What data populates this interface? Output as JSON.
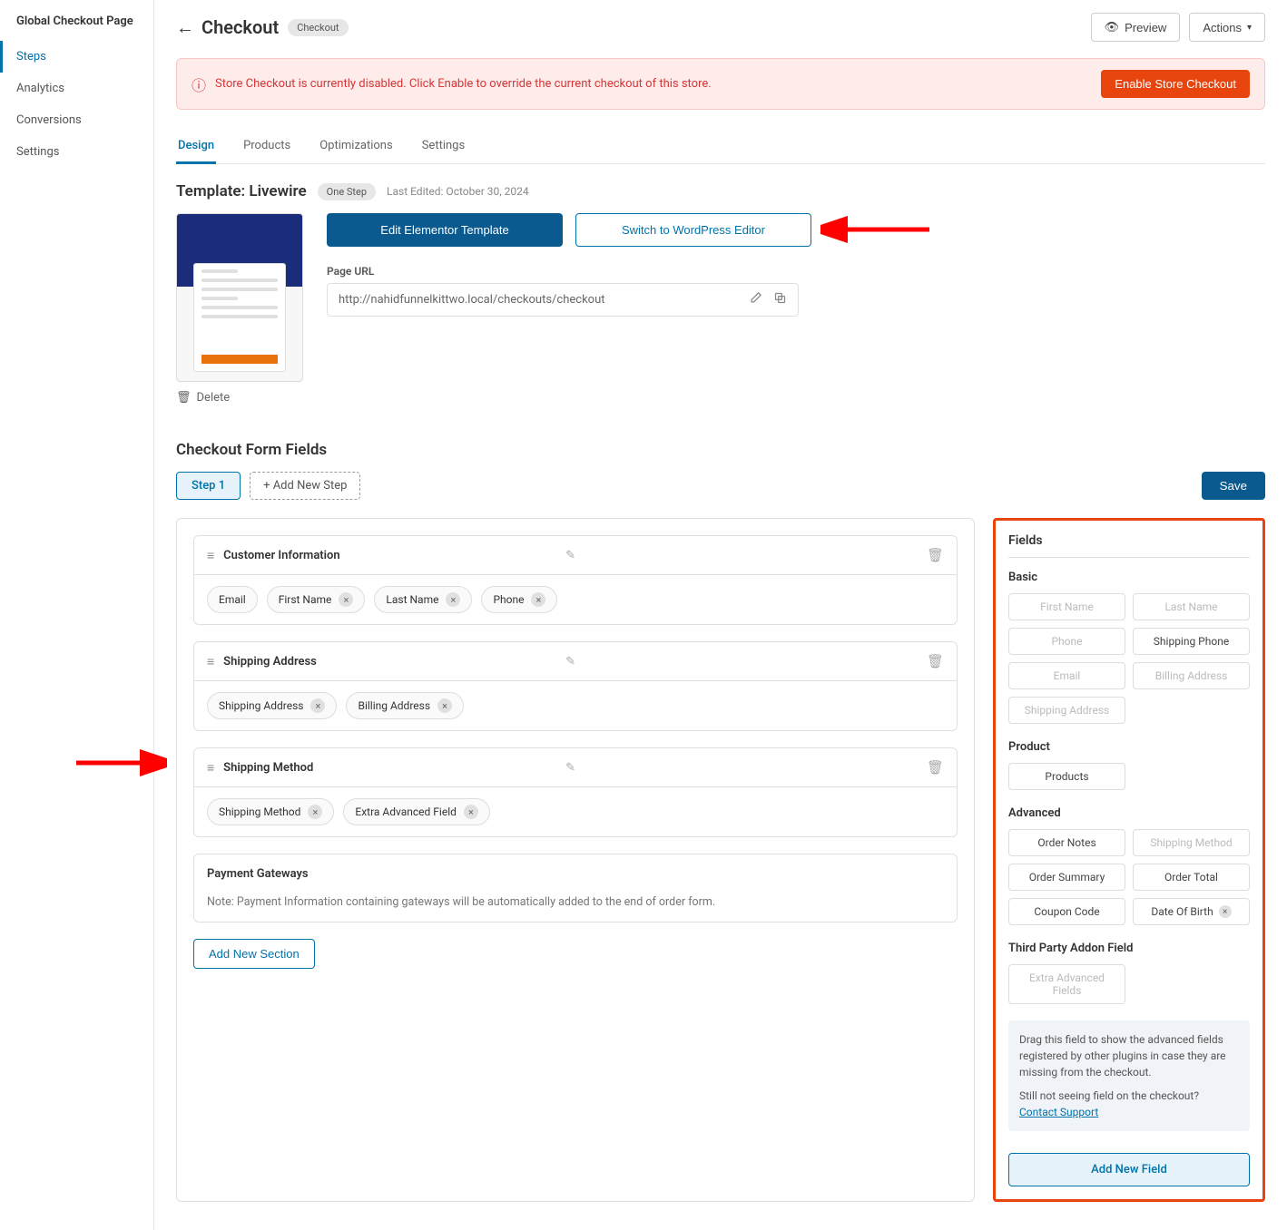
{
  "sidebar": {
    "title": "Global Checkout Page",
    "items": [
      {
        "label": "Steps",
        "active": true
      },
      {
        "label": "Analytics"
      },
      {
        "label": "Conversions"
      },
      {
        "label": "Settings"
      }
    ]
  },
  "header": {
    "title": "Checkout",
    "badge": "Checkout",
    "preview": "Preview",
    "actions": "Actions"
  },
  "alert": {
    "text": "Store Checkout is currently disabled. Click Enable to override the current checkout of this store.",
    "button": "Enable Store Checkout"
  },
  "tabs": [
    {
      "label": "Design",
      "active": true
    },
    {
      "label": "Products"
    },
    {
      "label": "Optimizations"
    },
    {
      "label": "Settings"
    }
  ],
  "template": {
    "label_prefix": "Template: ",
    "name": "Livewire",
    "step_badge": "One Step",
    "last_edited": "Last Edited: October 30, 2024",
    "edit_elementor": "Edit Elementor Template",
    "switch_wp": "Switch to WordPress Editor",
    "page_url_label": "Page URL",
    "page_url": "http://nahidfunnelkittwo.local/checkouts/checkout",
    "delete": "Delete"
  },
  "form_fields": {
    "title": "Checkout Form Fields",
    "step1": "Step 1",
    "add_step": "+ Add New Step",
    "save": "Save",
    "sections": [
      {
        "title": "Customer Information",
        "chips": [
          {
            "label": "Email",
            "removable": false
          },
          {
            "label": "First Name",
            "removable": true
          },
          {
            "label": "Last Name",
            "removable": true
          },
          {
            "label": "Phone",
            "removable": true
          }
        ]
      },
      {
        "title": "Shipping Address",
        "chips": [
          {
            "label": "Shipping Address",
            "removable": true
          },
          {
            "label": "Billing Address",
            "removable": true
          }
        ]
      },
      {
        "title": "Shipping Method",
        "chips": [
          {
            "label": "Shipping Method",
            "removable": true
          },
          {
            "label": "Extra Advanced Field",
            "removable": true
          }
        ]
      }
    ],
    "payment": {
      "title": "Payment Gateways",
      "note": "Note: Payment Information containing gateways will be automatically added to the end of order form."
    },
    "add_section": "Add New Section"
  },
  "panel": {
    "title": "Fields",
    "basic": {
      "title": "Basic",
      "items": [
        {
          "label": "First Name",
          "disabled": true
        },
        {
          "label": "Last Name",
          "disabled": true
        },
        {
          "label": "Phone",
          "disabled": true
        },
        {
          "label": "Shipping Phone",
          "disabled": false
        },
        {
          "label": "Email",
          "disabled": true
        },
        {
          "label": "Billing Address",
          "disabled": true
        },
        {
          "label": "Shipping Address",
          "disabled": true
        }
      ]
    },
    "product": {
      "title": "Product",
      "items": [
        {
          "label": "Products",
          "disabled": false
        }
      ]
    },
    "advanced": {
      "title": "Advanced",
      "items": [
        {
          "label": "Order Notes",
          "disabled": false
        },
        {
          "label": "Shipping Method",
          "disabled": true
        },
        {
          "label": "Order Summary",
          "disabled": false
        },
        {
          "label": "Order Total",
          "disabled": false
        },
        {
          "label": "Coupon Code",
          "disabled": false
        },
        {
          "label": "Date Of Birth",
          "disabled": false,
          "close": true
        }
      ]
    },
    "third": {
      "title": "Third Party Addon Field",
      "items": [
        {
          "label": "Extra Advanced Fields",
          "disabled": true
        }
      ]
    },
    "info1": "Drag this field to show the advanced fields registered by other plugins in case they are missing from the checkout.",
    "info2_prefix": "Still not seeing field on the checkout? ",
    "info2_link": "Contact Support",
    "add_field": "Add New Field"
  }
}
